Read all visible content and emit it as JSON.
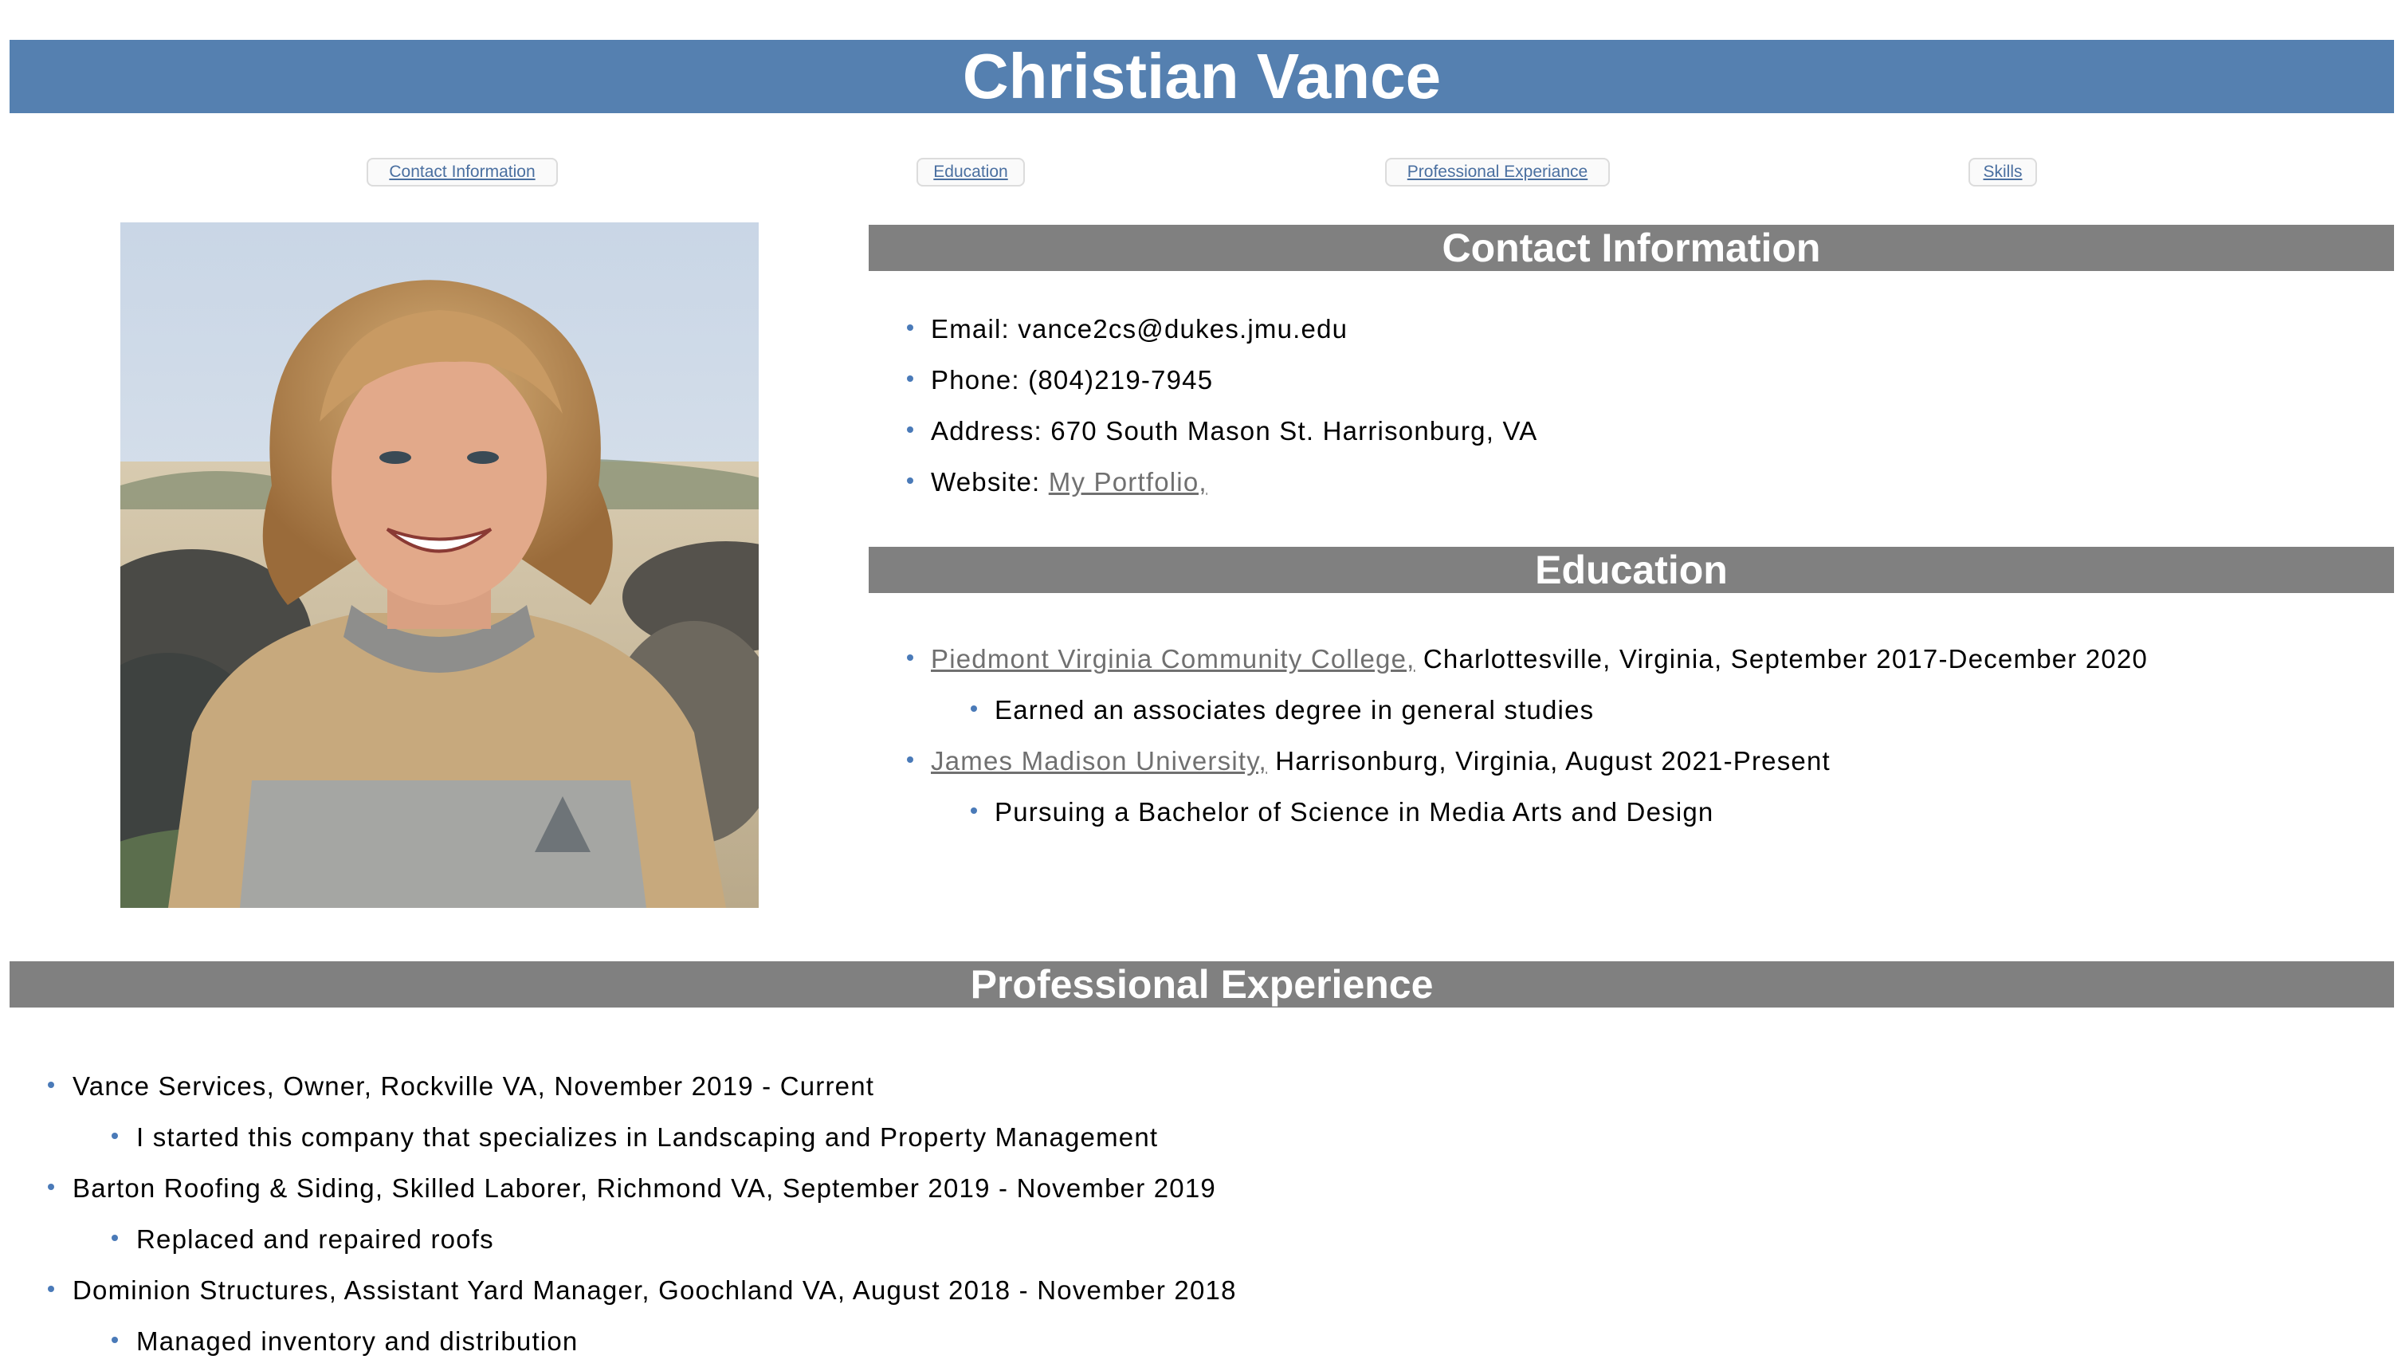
{
  "header": {
    "name": "Christian Vance"
  },
  "nav": {
    "contact": "Contact Information",
    "education": "Education",
    "experience": "Professional Experiance",
    "skills": "Skills"
  },
  "contact": {
    "heading": "Contact Information",
    "email_label": "Email: ",
    "email": "vance2cs@dukes.jmu.edu",
    "phone_label": "Phone: ",
    "phone": "(804)219-7945",
    "address_label": "Address: ",
    "address": "670 South Mason St. Harrisonburg, VA",
    "website_label": "Website: ",
    "website_link": "My Portfolio,"
  },
  "education": {
    "heading": "Education",
    "items": [
      {
        "school": "Piedmont Virginia Community College,",
        "details": " Charlottesville, Virginia, September 2017-December 2020",
        "sub": "Earned an associates degree in general studies"
      },
      {
        "school": "James Madison University,",
        "details": " Harrisonburg, Virginia, August 2021-Present",
        "sub": "Pursuing a Bachelor of Science in Media Arts and Design"
      }
    ]
  },
  "experience": {
    "heading": "Professional Experience",
    "items": [
      {
        "title": "Vance Services, Owner, Rockville VA, November 2019 - Current",
        "sub": "I started this company that specializes in Landscaping and Property Management"
      },
      {
        "title": "Barton Roofing & Siding, Skilled Laborer, Richmond VA, September 2019 - November 2019",
        "sub": "Replaced and repaired roofs"
      },
      {
        "title": "Dominion Structures, Assistant Yard Manager, Goochland VA, August 2018 - November 2018",
        "sub": "Managed inventory and distribution"
      }
    ]
  },
  "colors": {
    "banner": "#5580b0",
    "section_bar": "#808080",
    "bullet": "#4a7ab8",
    "link": "#707070"
  }
}
